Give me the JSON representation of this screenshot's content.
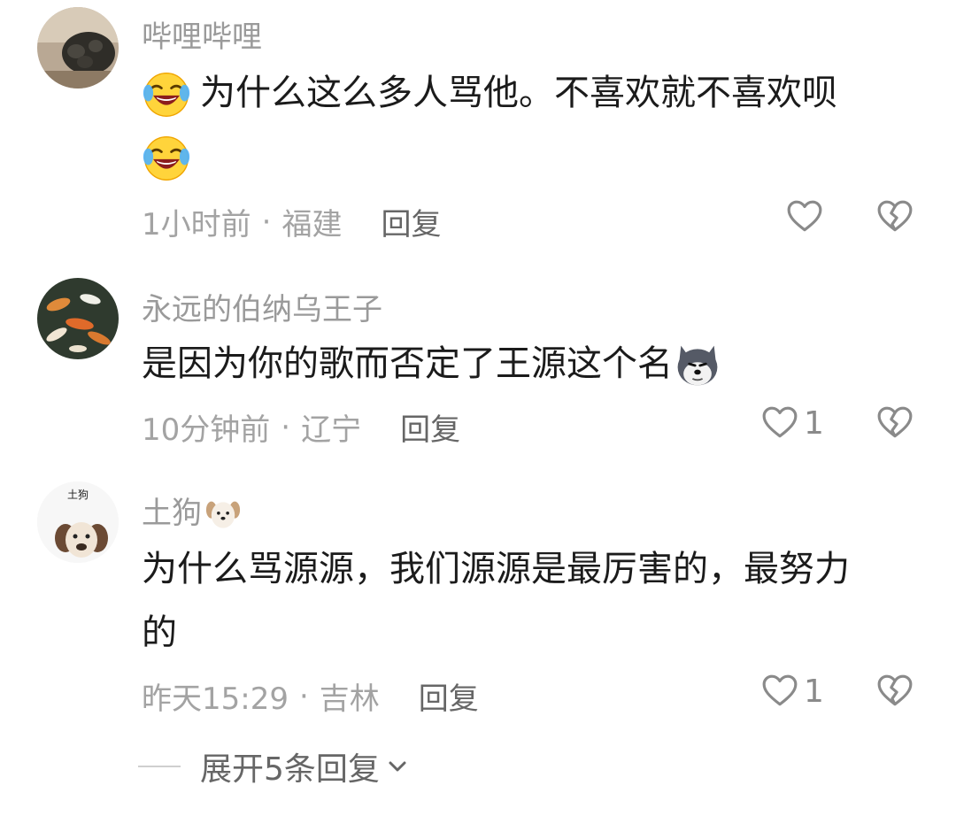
{
  "comments": [
    {
      "username": "哔哩哔哩",
      "text_line1": "为什么这么多人骂他。不喜欢就不喜欢呗",
      "time": "1小时前",
      "location": "福建",
      "reply_label": "回复",
      "like_count": "",
      "emoji": "crying-laughing"
    },
    {
      "username": "永远的伯纳乌王子",
      "text_line1": "是因为你的歌而否定了王源这个名",
      "time": "10分钟前",
      "location": "辽宁",
      "reply_label": "回复",
      "like_count": "1",
      "emoji": "husky-dog"
    },
    {
      "username": "土狗",
      "avatar_caption": "土狗",
      "text_line1": "为什么骂源源，我们源源是最厉害的，最努力",
      "text_line2": "的",
      "time": "昨天15:29",
      "location": "吉林",
      "reply_label": "回复",
      "like_count": "1",
      "emoji": "puppy-face"
    }
  ],
  "separator": "·",
  "expand_replies": "展开5条回复",
  "icons": {
    "like": "heart-outline-icon",
    "dislike": "broken-heart-outline-icon",
    "expand": "chevron-down-icon"
  },
  "colors": {
    "username": "#9a9a9a",
    "meta": "#a3a3a3",
    "reply": "#666666",
    "icon": "#8a8a8a"
  }
}
